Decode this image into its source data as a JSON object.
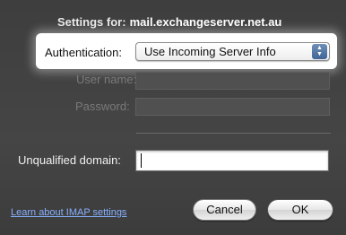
{
  "header": {
    "settings_for_label": "Settings for:",
    "account_host": "mail.exchangeserver.net.au"
  },
  "authentication": {
    "label": "Authentication:",
    "selected": "Use Incoming Server Info"
  },
  "fields": {
    "username_label": "User name:",
    "username_value": "",
    "password_label": "Password:",
    "password_value": "",
    "unqualified_domain_label": "Unqualified domain:",
    "unqualified_domain_value": ""
  },
  "footer": {
    "help_link": "Learn about IMAP settings",
    "cancel_label": "Cancel",
    "ok_label": "OK"
  },
  "colors": {
    "sheet_bg": "#424242",
    "link": "#87b0ff",
    "highlight": "#ffffff"
  }
}
